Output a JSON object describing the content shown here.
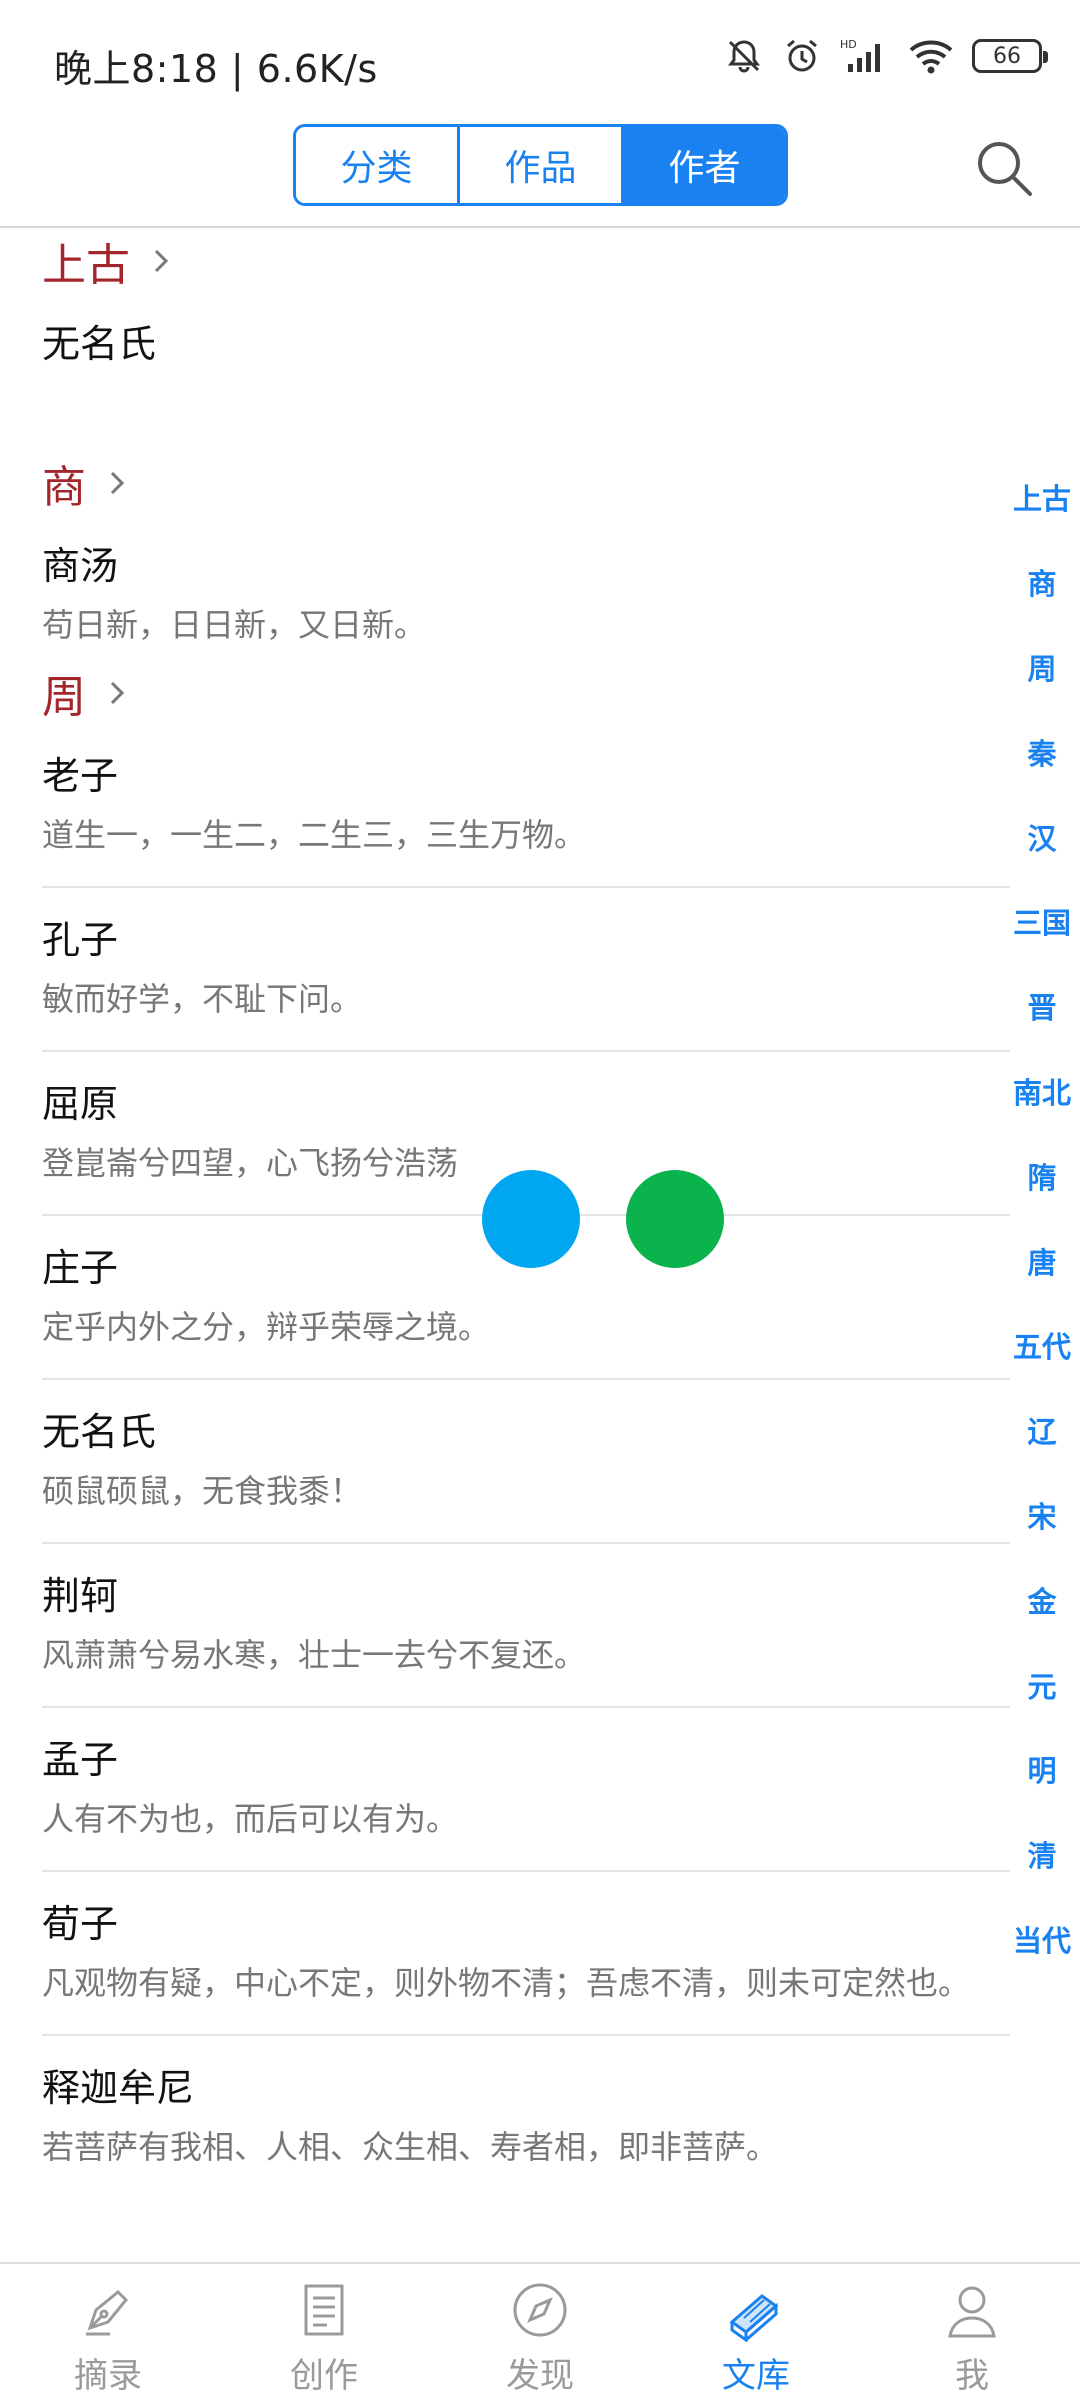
{
  "status": {
    "time_speed": "晚上8:18 | 6.6K/s",
    "battery": "66",
    "icons": [
      "mute-bell-icon",
      "alarm-icon",
      "hd-signal-icon",
      "wifi-icon",
      "battery-icon"
    ]
  },
  "header": {
    "tabs": [
      "分类",
      "作品",
      "作者"
    ],
    "active_tab": "作者",
    "search_icon": "search-icon"
  },
  "sections": [
    {
      "title": "上古",
      "items": [
        {
          "name": "无名氏",
          "quote": ""
        }
      ]
    },
    {
      "title": "商",
      "items": [
        {
          "name": "商汤",
          "quote": "苟日新，日日新，又日新。"
        }
      ]
    },
    {
      "title": "周",
      "items": [
        {
          "name": "老子",
          "quote": "道生一，一生二，二生三，三生万物。"
        },
        {
          "name": "孔子",
          "quote": "敏而好学，不耻下问。"
        },
        {
          "name": "屈原",
          "quote": "登崑崙兮四望，心飞扬兮浩荡"
        },
        {
          "name": "庄子",
          "quote": "定乎内外之分，辩乎荣辱之境。"
        },
        {
          "name": "无名氏",
          "quote": "硕鼠硕鼠，无食我黍！"
        },
        {
          "name": "荆轲",
          "quote": "风萧萧兮易水寒，壮士一去兮不复还。"
        },
        {
          "name": "孟子",
          "quote": "人有不为也，而后可以有为。"
        },
        {
          "name": "荀子",
          "quote": "凡观物有疑，中心不定，则外物不清；吾虑不清，则未可定然也。"
        },
        {
          "name": "释迦牟尼",
          "quote": "若菩萨有我相、人相、众生相、寿者相，即非菩萨。"
        }
      ]
    }
  ],
  "index": [
    "上古",
    "商",
    "周",
    "秦",
    "汉",
    "三国",
    "晋",
    "南北",
    "隋",
    "唐",
    "五代",
    "辽",
    "宋",
    "金",
    "元",
    "明",
    "清",
    "当代"
  ],
  "bottom_nav": [
    {
      "label": "摘录",
      "icon": "pen-nib-icon"
    },
    {
      "label": "创作",
      "icon": "document-icon"
    },
    {
      "label": "发现",
      "icon": "compass-icon"
    },
    {
      "label": "文库",
      "icon": "books-icon"
    },
    {
      "label": "我",
      "icon": "user-icon"
    }
  ],
  "active_nav": "文库",
  "colors": {
    "accent": "#1a82f0",
    "section_title": "#a3262d",
    "dot_blue": "#00a7f0",
    "dot_green": "#0ab34b"
  }
}
